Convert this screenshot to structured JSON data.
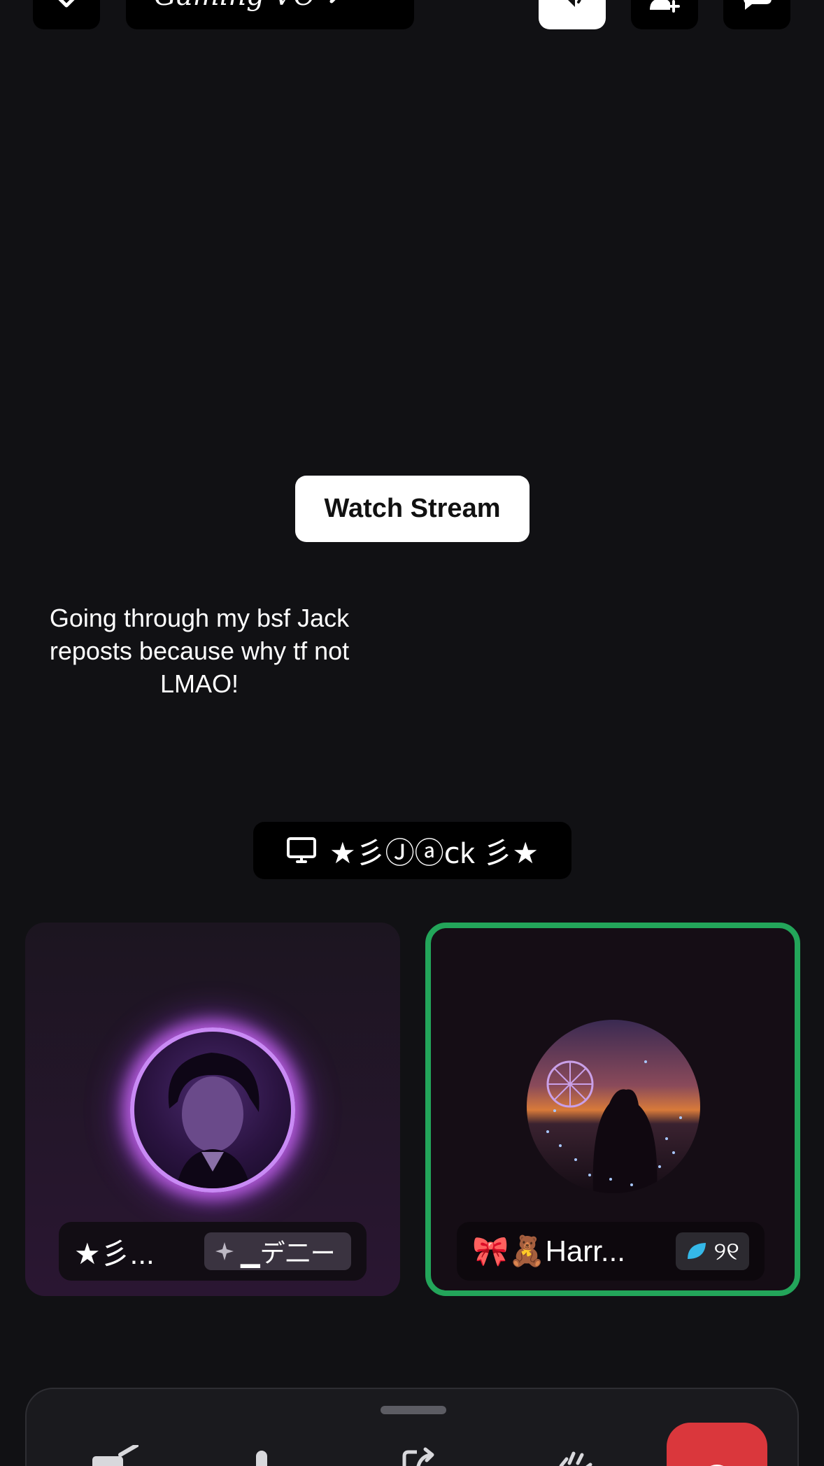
{
  "header": {
    "back_icon": "chevron-down-icon",
    "channel_title": "Gaming VC",
    "channel_chevron_icon": "chevron-right-icon",
    "speaker_icon": "speaker-icon",
    "invite_icon": "add-user-icon",
    "chat_icon": "chat-bubble-icon"
  },
  "stream": {
    "watch_label": "Watch Stream",
    "title": "Going through my bsf Jack reposts because why tf not LMAO!",
    "streamer_icon": "monitor-icon",
    "streamer_name": "★彡Ⓙⓐⅽk 彡★"
  },
  "participants": [
    {
      "name": "★彡...",
      "tag_icon": "sparkle-icon",
      "tag": "▁デ二ー",
      "speaking": false,
      "ring_color": "#c98af5"
    },
    {
      "name": "🎀🧸Harr...",
      "tag_icon": "leaf-icon",
      "tag": "୨୧",
      "speaking": true,
      "ring_color": "#23a55a"
    }
  ],
  "controls": {
    "camera_icon": "camera-off-icon",
    "mic_icon": "microphone-icon",
    "share_icon": "screen-share-icon",
    "activity_icon": "activity-icon",
    "end_call_icon": "end-call-icon",
    "end_call_color": "#da373c"
  }
}
